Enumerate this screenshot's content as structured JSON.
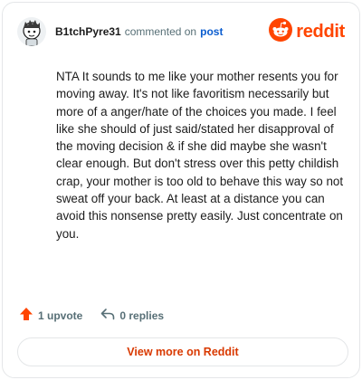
{
  "header": {
    "username": "B1tchPyre31",
    "action_text": "commented on",
    "post_link": "post",
    "brand_name": "reddit"
  },
  "icons": {
    "avatar": "snoo-avatar-icon",
    "brand": "reddit-alien-icon",
    "upvote": "upvote-arrow-icon",
    "replies": "reply-arrow-icon"
  },
  "comment": {
    "text": "NTA It sounds to me like your mother resents you for moving away. It's not like favoritism necessarily but more of a anger/hate of the choices you made. I feel like she should of just said/stated her disapproval of the moving decision & if she did maybe she wasn't clear enough. But don't stress over this petty childish crap, your mother is too old to behave this way so not sweat off your back. At least at a distance you can avoid this nonsense pretty easily. Just concentrate on you."
  },
  "actions": {
    "upvotes": "1 upvote",
    "replies": "0 replies"
  },
  "footer": {
    "view_more": "View more on Reddit"
  },
  "colors": {
    "brand": "#ff4500",
    "link": "#0a5ccf",
    "muted": "#576f76",
    "cta": "#d93900",
    "border": "#e4e6e8"
  }
}
